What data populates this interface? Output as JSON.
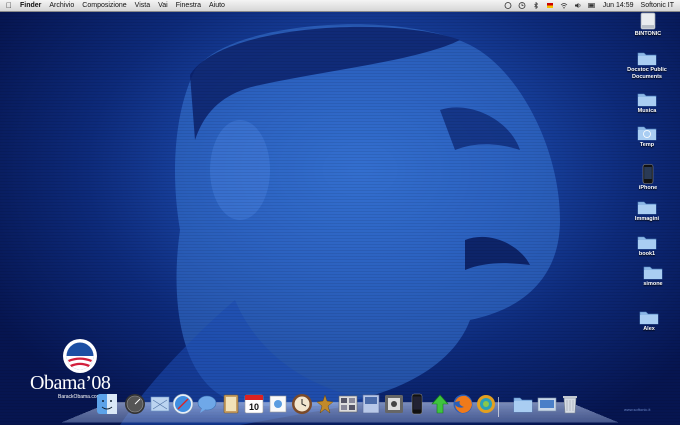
{
  "menubar": {
    "items": [
      "Finder",
      "Archivio",
      "Composizione",
      "Vista",
      "Vai",
      "Finestra",
      "Aiuto"
    ],
    "clock": "Jun 14:59",
    "user": "Softonic IT"
  },
  "desktop_icons": [
    {
      "label": "BINTONIC",
      "icon": "hard-drive-icon"
    },
    {
      "label": "Docstoc Public Documents",
      "icon": "folder-icon"
    },
    {
      "label": "Musica",
      "icon": "folder-icon"
    },
    {
      "label": "Temp",
      "icon": "folder-icon"
    },
    {
      "label": "iPhone",
      "icon": "iphone-icon"
    },
    {
      "label": "Immagini",
      "icon": "folder-icon"
    },
    {
      "label": "book1",
      "icon": "folder-icon"
    },
    {
      "label": "simone",
      "icon": "folder-icon"
    },
    {
      "label": "Alex",
      "icon": "folder-icon"
    }
  ],
  "logo": {
    "wordmark": "Obama’08",
    "url": "BarackObama.com"
  },
  "dock": {
    "items": [
      "finder-icon",
      "dashboard-icon",
      "mail-icon",
      "safari-icon",
      "ichat-icon",
      "address-book-icon",
      "ical-icon",
      "preview-icon",
      "time-machine-icon",
      "system-preferences-icon",
      "photo-icon",
      "itunes-icon",
      "iphone-icon",
      "update-icon",
      "firefox-icon",
      "app-icon",
      "documents-folder-icon",
      "applications-folder-icon",
      "trash-icon"
    ],
    "calendar_day": "10"
  },
  "watermark": "www.softonic.it"
}
